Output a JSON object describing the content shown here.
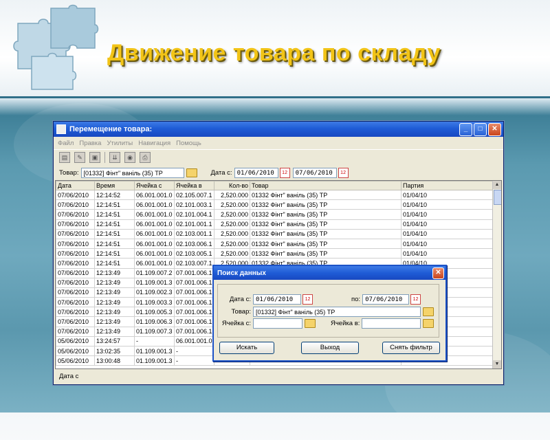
{
  "slide": {
    "title": "Движение товара по складу"
  },
  "window": {
    "title": "Перемещение товара:",
    "menu": [
      "Файл",
      "Правка",
      "Утилиты",
      "Навигация",
      "Помощь"
    ],
    "filter": {
      "product_label": "Товар:",
      "product_value": "[01332] Фінт\" ваніль (35) ТР",
      "date_from_label": "Дата с:",
      "date_from": "01/06/2010",
      "date_to": "07/06/2010"
    },
    "columns": [
      "Дата",
      "Время",
      "Ячейка с",
      "Ячейка в",
      "Кол-во",
      "Товар",
      "Партия"
    ],
    "rows": [
      [
        "07/06/2010",
        "12:14:52",
        "06.001.001.0",
        "02.105.007.1",
        "2,520.000",
        "01332 Фінт\" ваніль (35) ТР",
        "01/04/10"
      ],
      [
        "07/06/2010",
        "12:14:51",
        "06.001.001.0",
        "02.101.003.1",
        "2,520.000",
        "01332 Фінт\" ваніль (35) ТР",
        "01/04/10"
      ],
      [
        "07/06/2010",
        "12:14:51",
        "06.001.001.0",
        "02.101.004.1",
        "2,520.000",
        "01332 Фінт\" ваніль (35) ТР",
        "01/04/10"
      ],
      [
        "07/06/2010",
        "12:14:51",
        "06.001.001.0",
        "02.101.001.1",
        "2,520.000",
        "01332 Фінт\" ваніль (35) ТР",
        "01/04/10"
      ],
      [
        "07/06/2010",
        "12:14:51",
        "06.001.001.0",
        "02.103.001.1",
        "2,520.000",
        "01332 Фінт\" ваніль (35) ТР",
        "01/04/10"
      ],
      [
        "07/06/2010",
        "12:14:51",
        "06.001.001.0",
        "02.103.006.1",
        "2,520.000",
        "01332 Фінт\" ваніль (35) ТР",
        "01/04/10"
      ],
      [
        "07/06/2010",
        "12:14:51",
        "06.001.001.0",
        "02.103.005.1",
        "2,520.000",
        "01332 Фінт\" ваніль (35) ТР",
        "01/04/10"
      ],
      [
        "07/06/2010",
        "12:14:51",
        "06.001.001.0",
        "02.103.007.1",
        "2,520.000",
        "01332 Фінт\" ваніль (35) ТР",
        "01/04/10"
      ],
      [
        "07/06/2010",
        "12:13:49",
        "01.109.007.2",
        "07.001.006.1",
        "",
        "",
        ""
      ],
      [
        "07/06/2010",
        "12:13:49",
        "01.109.001.3",
        "07.001.006.1",
        "",
        "",
        ""
      ],
      [
        "07/06/2010",
        "12:13:49",
        "01.109.002.3",
        "07.001.006.1",
        "",
        "",
        ""
      ],
      [
        "07/06/2010",
        "12:13:49",
        "01.109.003.3",
        "07.001.006.1",
        "",
        "",
        ""
      ],
      [
        "07/06/2010",
        "12:13:49",
        "01.109.005.3",
        "07.001.006.1",
        "",
        "",
        ""
      ],
      [
        "07/06/2010",
        "12:13:49",
        "01.109.006.3",
        "07.001.006.1",
        "",
        "",
        ""
      ],
      [
        "07/06/2010",
        "12:13:49",
        "01.109.007.3",
        "07.001.006.1",
        "",
        "",
        ""
      ],
      [
        "05/06/2010",
        "13:24:57",
        "-",
        "06.001.001.0",
        "",
        "",
        ""
      ],
      [
        "05/06/2010",
        "13:02:35",
        "01.109.001.3",
        "-",
        "",
        "",
        ""
      ],
      [
        "05/06/2010",
        "13:00:48",
        "01.109.001.3",
        "-",
        "",
        "",
        ""
      ]
    ],
    "status": "Дата с"
  },
  "dialog": {
    "title": "Поиск данных",
    "date_from_label": "Дата с:",
    "date_from": "01/06/2010",
    "date_to_label": "по:",
    "date_to": "07/06/2010",
    "product_label": "Товар:",
    "product_value": "[01332]  Фінт\" ваніль (35) ТР",
    "cell_from_label": "Ячейка с:",
    "cell_from": "",
    "cell_to_label": "Ячейка в:",
    "cell_to": "",
    "search_button": "Искать",
    "exit_button": "Выход",
    "clear_filter_button": "Снять фильтр"
  },
  "icons": [
    "puzzle-graphic",
    "window-icon",
    "minimize-icon",
    "maximize-icon",
    "close-icon",
    "calendar-icon",
    "folder-icon",
    "toolbar-icons"
  ]
}
